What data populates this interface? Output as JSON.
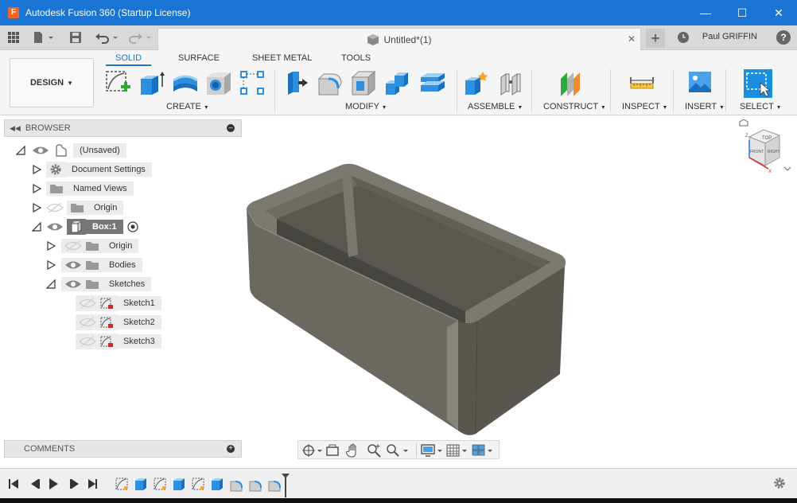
{
  "window": {
    "title": "Autodesk Fusion 360 (Startup License)",
    "app_icon_letter": "F",
    "controls": {
      "minimize": "—",
      "maximize": "☐",
      "close": "✕"
    }
  },
  "quick_access": {
    "document_tab": {
      "label": "Untitled*(1)",
      "close": "✕"
    },
    "new_tab": "+",
    "user_name": "Paul GRIFFIN",
    "help": "?"
  },
  "ribbon": {
    "workspace": "DESIGN",
    "tabs": [
      {
        "label": "SOLID",
        "active": true
      },
      {
        "label": "SURFACE",
        "active": false
      },
      {
        "label": "SHEET METAL",
        "active": false
      },
      {
        "label": "TOOLS",
        "active": false
      }
    ],
    "groups": [
      "CREATE",
      "MODIFY",
      "ASSEMBLE",
      "CONSTRUCT",
      "INSPECT",
      "INSERT",
      "SELECT"
    ]
  },
  "browser": {
    "title": "BROWSER",
    "items": [
      {
        "label": "(Unsaved)"
      },
      {
        "label": "Document Settings"
      },
      {
        "label": "Named Views"
      },
      {
        "label": "Origin"
      },
      {
        "label": "Box:1"
      },
      {
        "label": "Origin"
      },
      {
        "label": "Bodies"
      },
      {
        "label": "Sketches"
      },
      {
        "label": "Sketch1"
      },
      {
        "label": "Sketch2"
      },
      {
        "label": "Sketch3"
      }
    ]
  },
  "comments": {
    "title": "COMMENTS"
  },
  "viewcube": {
    "front": "FRONT",
    "top": "TOP",
    "right": "RIGHT",
    "axis_x": "X",
    "axis_z": "Z"
  },
  "colors": {
    "titlebar": "#1a74d3",
    "accent": "#1a74d3",
    "model": "#6b685f"
  }
}
